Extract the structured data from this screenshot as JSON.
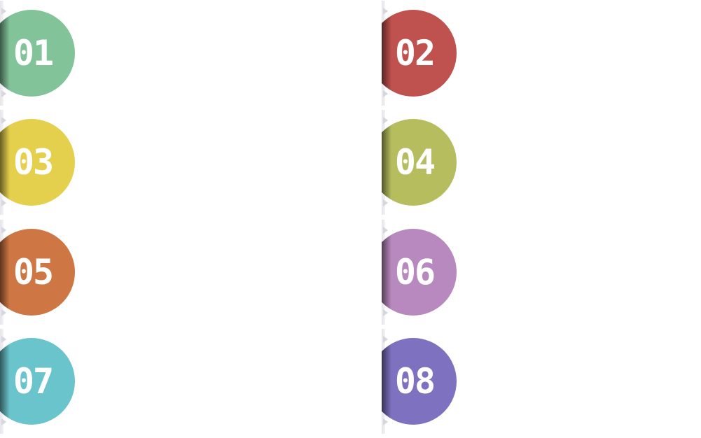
{
  "items": [
    {
      "number": "01",
      "color": "#82c39a"
    },
    {
      "number": "02",
      "color": "#bf514e"
    },
    {
      "number": "03",
      "color": "#e4d04c"
    },
    {
      "number": "04",
      "color": "#b6bd5f"
    },
    {
      "number": "05",
      "color": "#cf7744"
    },
    {
      "number": "06",
      "color": "#b889bf"
    },
    {
      "number": "07",
      "color": "#6ac4cc"
    },
    {
      "number": "08",
      "color": "#7e71c0"
    }
  ]
}
